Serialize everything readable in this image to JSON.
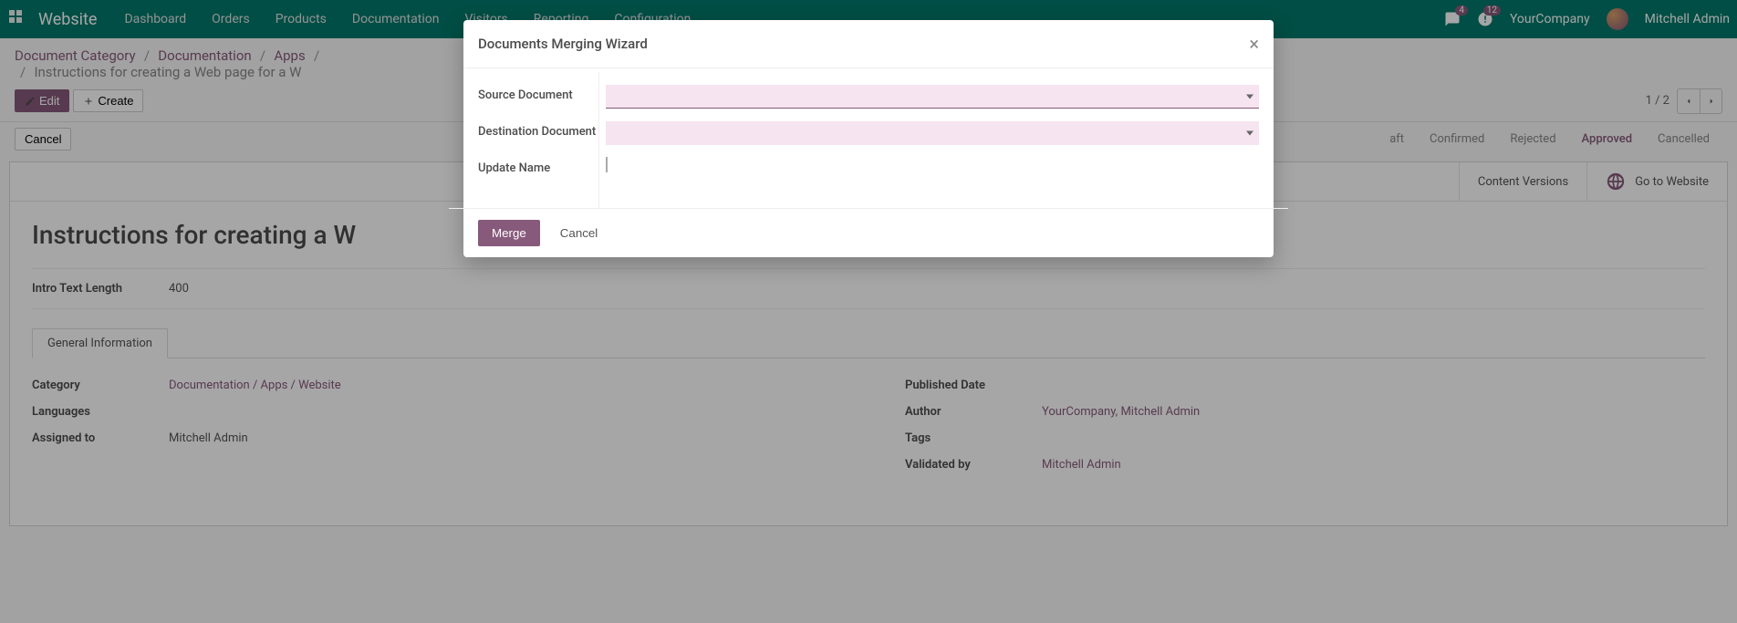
{
  "topbar": {
    "brand": "Website",
    "nav": [
      "Dashboard",
      "Orders",
      "Products",
      "Documentation",
      "Visitors",
      "Reporting",
      "Configuration"
    ],
    "chat_badge": "4",
    "activity_badge": "12",
    "company": "YourCompany",
    "user": "Mitchell Admin"
  },
  "breadcrumb": {
    "items": [
      "Document Category",
      "Documentation",
      "Apps"
    ],
    "current": "Instructions for creating a Web page for a W"
  },
  "actions": {
    "edit": "Edit",
    "create": "Create",
    "cancel": "Cancel"
  },
  "pager": {
    "text": "1 / 2"
  },
  "statuses": [
    "aft",
    "Confirmed",
    "Rejected",
    "Approved",
    "Cancelled"
  ],
  "status_active_index": 3,
  "statbtns": {
    "content_versions": "Content Versions",
    "go_to_website": "Go to Website"
  },
  "doc": {
    "title": "Instructions for creating a W",
    "intro_len_label": "Intro Text Length",
    "intro_len": "400",
    "tab": "General Information",
    "left": {
      "category_label": "Category",
      "category": "Documentation / Apps / Website",
      "languages_label": "Languages",
      "languages": "",
      "assigned_label": "Assigned to",
      "assigned": "Mitchell Admin"
    },
    "right": {
      "published_label": "Published Date",
      "published": "",
      "author_label": "Author",
      "author": "YourCompany, Mitchell Admin",
      "tags_label": "Tags",
      "tags": "",
      "validated_label": "Validated by",
      "validated": "Mitchell Admin"
    }
  },
  "modal": {
    "title": "Documents Merging Wizard",
    "src_label": "Source Document",
    "dst_label": "Destination Document",
    "upd_label": "Update Name",
    "merge": "Merge",
    "cancel": "Cancel"
  },
  "colors": {
    "accent": "#875A7B",
    "teal": "#00796b"
  }
}
